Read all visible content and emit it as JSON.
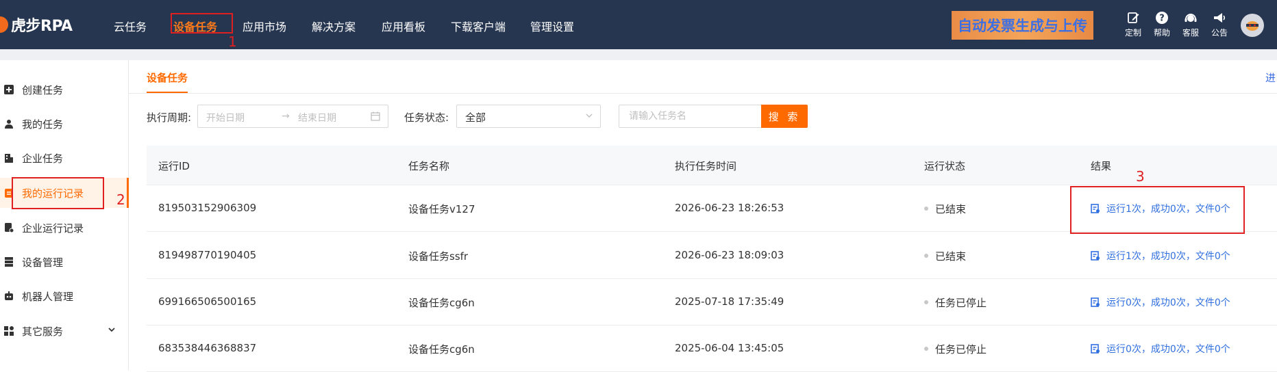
{
  "header": {
    "logo_text": "虎步RPA",
    "nav": [
      "云任务",
      "设备任务",
      "应用市场",
      "解决方案",
      "应用看板",
      "下载客户端",
      "管理设置"
    ],
    "active_nav": "设备任务",
    "banner_text": "自动发票生成与上传",
    "tools": [
      {
        "label": "定制",
        "icon": "edit-icon"
      },
      {
        "label": "帮助",
        "icon": "help-icon"
      },
      {
        "label": "客服",
        "icon": "headset-icon"
      },
      {
        "label": "公告",
        "icon": "megaphone-icon"
      }
    ]
  },
  "sidebar": {
    "items": [
      {
        "label": "创建任务",
        "icon": "plus-square-icon"
      },
      {
        "label": "我的任务",
        "icon": "user-icon"
      },
      {
        "label": "企业任务",
        "icon": "building-icon"
      },
      {
        "label": "我的运行记录",
        "icon": "clipboard-icon",
        "active": true
      },
      {
        "label": "企业运行记录",
        "icon": "record-icon"
      },
      {
        "label": "设备管理",
        "icon": "server-icon"
      },
      {
        "label": "机器人管理",
        "icon": "robot-icon"
      },
      {
        "label": "其它服务",
        "icon": "grid-icon"
      }
    ]
  },
  "main": {
    "tab": "设备任务",
    "tab_right_text": "进",
    "filters": {
      "period_label": "执行周期:",
      "start_placeholder": "开始日期",
      "arrow": "→",
      "end_placeholder": "结束日期",
      "status_label": "任务状态:",
      "status_value": "全部",
      "search_placeholder": "请输入任务名",
      "search_button": "搜 索"
    },
    "table": {
      "columns": [
        "运行ID",
        "任务名称",
        "执行任务时间",
        "运行状态",
        "结果"
      ],
      "rows": [
        {
          "id": "819503152906309",
          "name": "设备任务v127",
          "time": "2026-06-23 18:26:53",
          "status": "已结束",
          "result": "运行1次，成功0次，文件0个"
        },
        {
          "id": "819498770190405",
          "name": "设备任务ssfr",
          "time": "2026-06-23 18:09:03",
          "status": "已结束",
          "result": "运行1次，成功0次，文件0个"
        },
        {
          "id": "699166506500165",
          "name": "设备任务cg6n",
          "time": "2025-07-18 17:35:49",
          "status": "任务已停止",
          "result": "运行0次，成功0次，文件0个"
        },
        {
          "id": "683538446368837",
          "name": "设备任务cg6n",
          "time": "2025-06-04 13:45:05",
          "status": "任务已停止",
          "result": "运行0次，成功0次，文件0个"
        }
      ]
    }
  },
  "annotations": [
    "1",
    "2",
    "3"
  ],
  "colors": {
    "header_bg": "#263650",
    "accent": "#ff6a00",
    "link": "#2f6fe0",
    "annotation": "#e02020"
  }
}
